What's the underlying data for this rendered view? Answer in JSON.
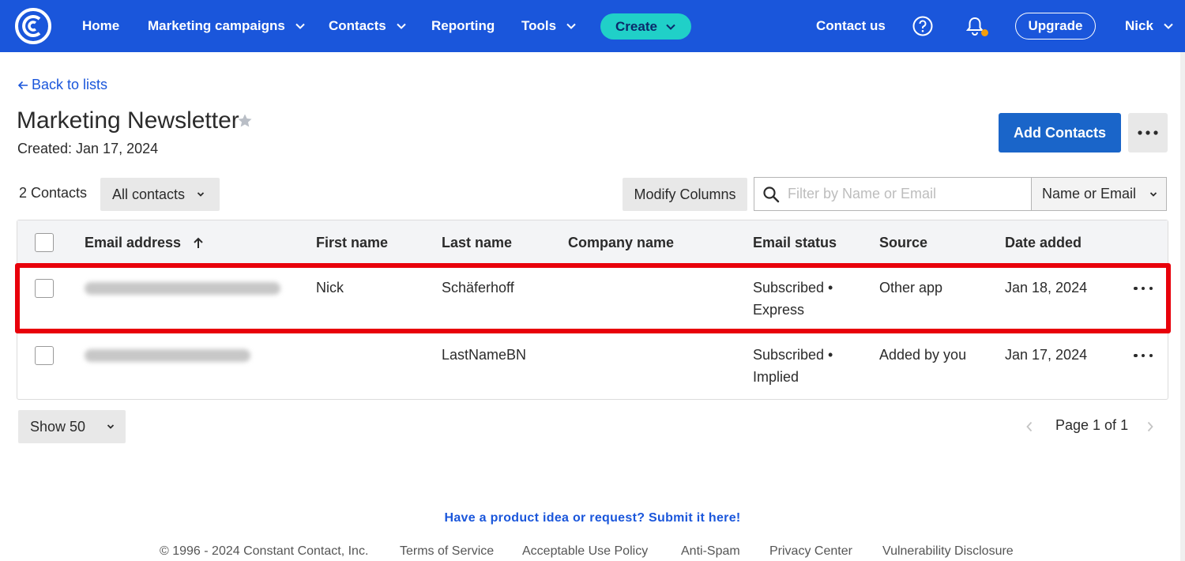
{
  "nav": {
    "home": "Home",
    "marketing_campaigns": "Marketing campaigns",
    "contacts": "Contacts",
    "reporting": "Reporting",
    "tools": "Tools",
    "create": "Create",
    "contact_us": "Contact us",
    "upgrade": "Upgrade",
    "user": "Nick",
    "brand_color": "#1a56db",
    "accent_color": "#20d0c8"
  },
  "page": {
    "back_link": "Back to lists",
    "title": "Marketing Newsletter",
    "created": "Created: Jan 17, 2024",
    "add_contacts": "Add Contacts"
  },
  "toolbar": {
    "count": "2 Contacts",
    "filter": "All contacts",
    "modify_columns": "Modify Columns",
    "search_placeholder": "Filter by Name or Email",
    "search_scope": "Name or Email"
  },
  "table": {
    "columns": [
      "Email address",
      "First name",
      "Last name",
      "Company name",
      "Email status",
      "Source",
      "Date added"
    ],
    "rows": [
      {
        "email": "",
        "first_name": "Nick",
        "last_name": "Schäferhoff",
        "company": "",
        "status_line1": "Subscribed •",
        "status_line2": "Express",
        "source": "Other app",
        "date_added": "Jan 18, 2024",
        "highlighted": true
      },
      {
        "email": "",
        "first_name": "",
        "last_name": "LastNameBN",
        "company": "",
        "status_line1": "Subscribed •",
        "status_line2": "Implied",
        "source": "Added by you",
        "date_added": "Jan 17, 2024",
        "highlighted": false
      }
    ]
  },
  "pagination": {
    "show": "Show 50",
    "page": "Page 1 of 1"
  },
  "footer": {
    "idea_link": "Have a product idea or request? Submit it here!",
    "copyright": "© 1996 - 2024 Constant Contact, Inc.",
    "links": [
      "Terms of Service",
      "Acceptable Use Policy",
      "Anti-Spam",
      "Privacy Center",
      "Vulnerability Disclosure"
    ]
  },
  "icons": {
    "logo": "constant-contact-logo-icon",
    "help": "question-circle-icon",
    "notifications": "bell-icon",
    "search": "search-icon",
    "star": "star-icon",
    "sort": "arrow-up-icon"
  }
}
